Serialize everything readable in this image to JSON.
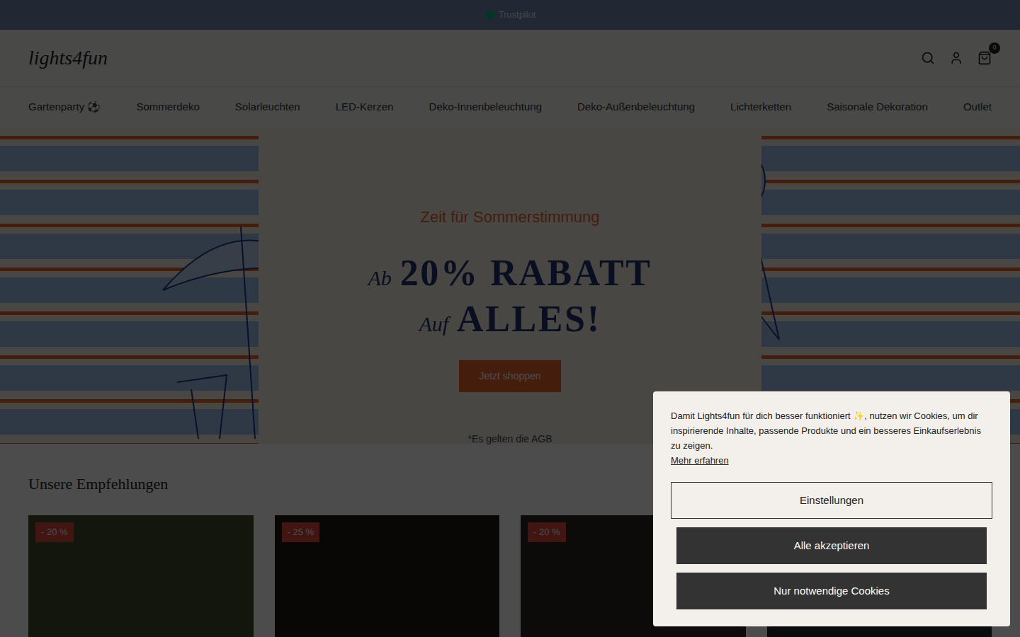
{
  "announcement_bar": {
    "label": "Trustpilot"
  },
  "header": {
    "logo": "lights4fun",
    "cart_count": "0"
  },
  "nav": [
    {
      "label": "Gartenparty ⚽"
    },
    {
      "label": "Sommerdeko"
    },
    {
      "label": "Solarleuchten"
    },
    {
      "label": "LED-Kerzen"
    },
    {
      "label": "Deko-Innenbeleuchtung"
    },
    {
      "label": "Deko-Außenbeleuchtung"
    },
    {
      "label": "Lichterketten"
    },
    {
      "label": "Saisonale Dekoration"
    },
    {
      "label": "Outlet"
    }
  ],
  "hero": {
    "kicker": "Zeit für Sommerstimmung",
    "line1_prefix": "Ab",
    "line1": "20% RABATT",
    "line2_prefix": "Auf",
    "line2": "ALLES!",
    "button": "Jetzt shoppen",
    "note": "*Es gelten die AGB"
  },
  "recommendations": {
    "title": "Unsere Empfehlungen",
    "products": [
      {
        "badge": "- 20 %"
      },
      {
        "badge": "- 25 %"
      },
      {
        "badge": "- 20 %"
      },
      {}
    ]
  },
  "cookie_banner": {
    "text": "Damit Lights4fun für dich besser funktioniert ✨, nutzen wir Cookies, um dir inspirierende Inhalte, passende Produkte und ein besseres Einkaufserlebnis zu zeigen.",
    "link": "Mehr erfahren",
    "buttons": [
      {
        "label": "Einstellungen",
        "kind": "outline"
      },
      {
        "label": "Alle akzeptieren",
        "kind": "filled"
      },
      {
        "label": "Nur notwendige Cookies",
        "kind": "filled"
      }
    ]
  }
}
